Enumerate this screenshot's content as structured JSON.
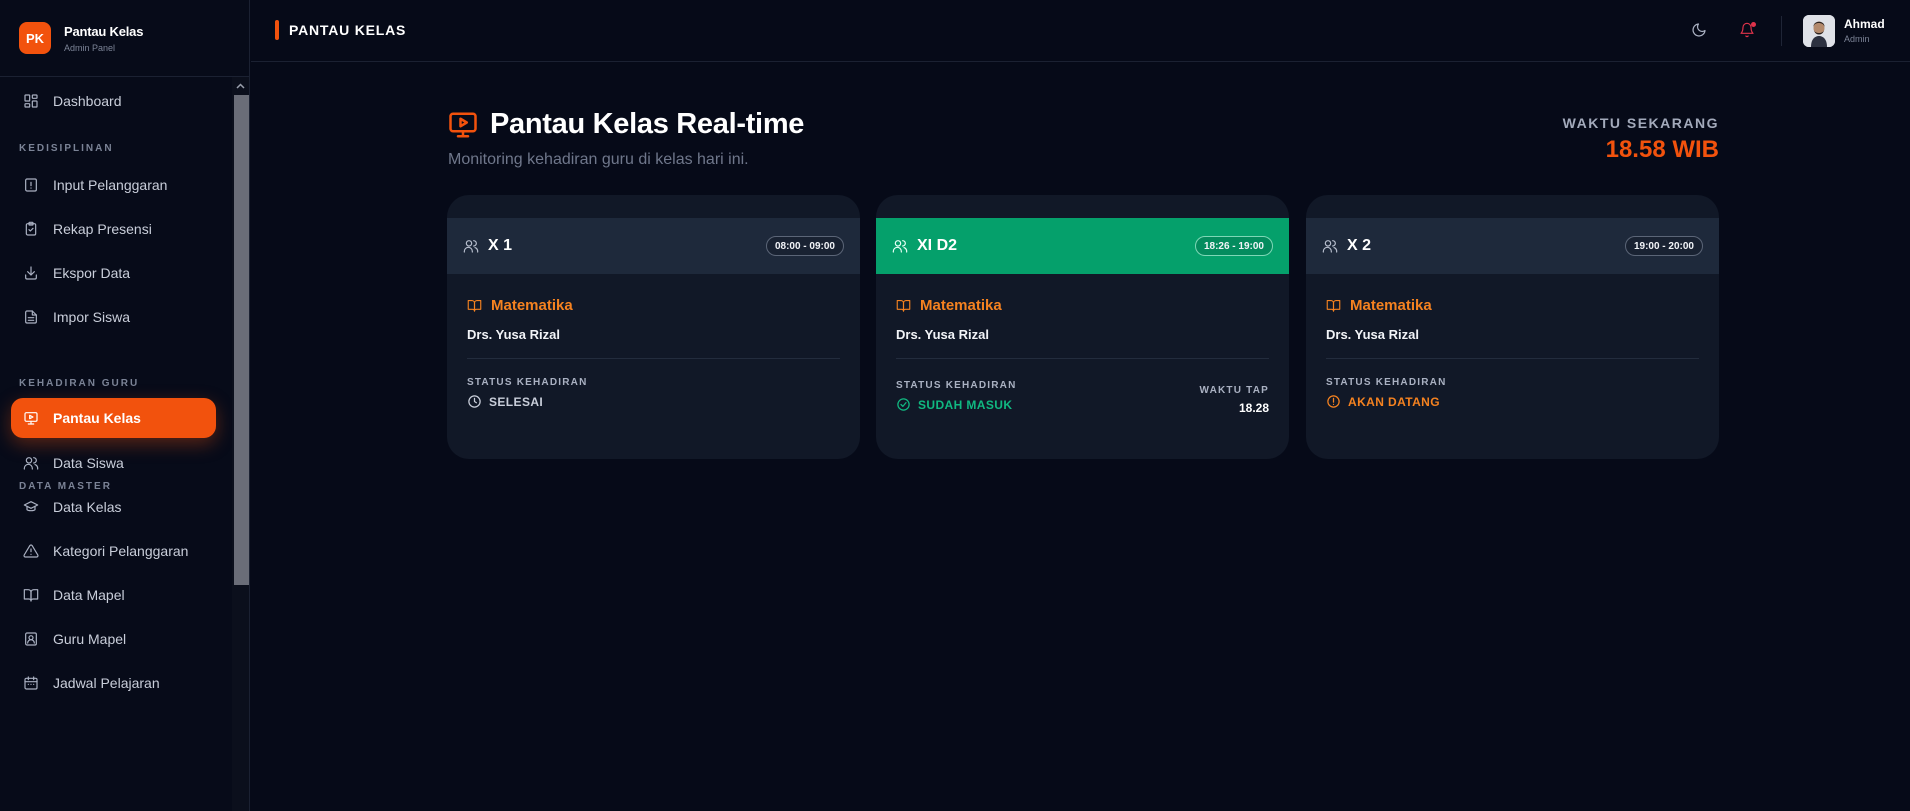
{
  "app": {
    "title": "Pantau Kelas",
    "subtitle": "Admin Panel",
    "logo_text": "PK"
  },
  "sidebar": {
    "items": [
      {
        "label": "Dashboard",
        "icon": "dashboard-grid-icon"
      },
      {
        "label": "Input Pelanggaran",
        "icon": "alert-square-icon"
      },
      {
        "label": "Rekap Presensi",
        "icon": "clipboard-check-icon"
      },
      {
        "label": "Ekspor Data",
        "icon": "download-icon"
      },
      {
        "label": "Impor Siswa",
        "icon": "file-text-icon"
      },
      {
        "label": "Pantau Kelas",
        "icon": "monitor-play-icon",
        "active": true
      },
      {
        "label": "Data Siswa",
        "icon": "users-icon"
      },
      {
        "label": "Data Kelas",
        "icon": "graduation-cap-icon"
      },
      {
        "label": "Kategori Pelanggaran",
        "icon": "warning-triangle-icon"
      },
      {
        "label": "Data Mapel",
        "icon": "book-open-icon"
      },
      {
        "label": "Guru Mapel",
        "icon": "contact-card-icon"
      },
      {
        "label": "Jadwal Pelajaran",
        "icon": "calendar-icon"
      }
    ],
    "sections": [
      "KEDISIPLINAN",
      "KEHADIRAN GURU",
      "DATA MASTER"
    ]
  },
  "topbar": {
    "page_label": "PANTAU KELAS",
    "user_name": "Ahmad",
    "user_role": "Admin"
  },
  "main": {
    "title": "Pantau Kelas Real-time",
    "subtitle": "Monitoring kehadiran guru di kelas hari ini.",
    "clock_label": "WAKTU SEKARANG",
    "clock_value": "18.58 WIB",
    "cards": [
      {
        "class_name": "X 1",
        "time": "08:00 - 09:00",
        "subject": "Matematika",
        "teacher": "Drs. Yusa Rizal",
        "status_label": "STATUS KEHADIRAN",
        "status": "SELESAI",
        "status_color": "#c9ceda"
      },
      {
        "class_name": "XI D2",
        "time": "18:26 - 19:00",
        "subject": "Matematika",
        "teacher": "Drs. Yusa Rizal",
        "status_label": "STATUS KEHADIRAN",
        "status": "SUDAH MASUK",
        "status_color": "#10b981",
        "tap_label": "WAKTU TAP",
        "tap_time": "18.28"
      },
      {
        "class_name": "X 2",
        "time": "19:00 - 20:00",
        "subject": "Matematika",
        "teacher": "Drs. Yusa Rizal",
        "status_label": "STATUS KEHADIRAN",
        "status": "AKAN DATANG",
        "status_color": "#f58220"
      }
    ]
  },
  "colors": {
    "accent": "#f2520d",
    "ongoing": "#05a06b",
    "background": "#060a18"
  }
}
